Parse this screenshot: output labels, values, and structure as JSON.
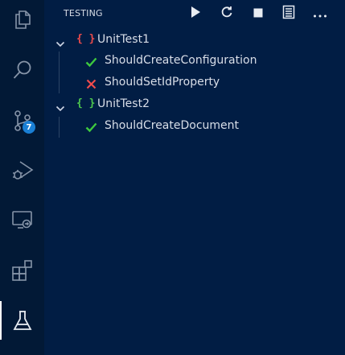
{
  "sidebar": {
    "title": "TESTING",
    "toolbar": [
      {
        "name": "run-all-tests-button",
        "icon": "play-icon"
      },
      {
        "name": "refresh-tests-button",
        "icon": "refresh-icon"
      },
      {
        "name": "stop-button",
        "icon": "stop-icon"
      },
      {
        "name": "show-output-button",
        "icon": "output-icon"
      },
      {
        "name": "more-actions-button",
        "icon": "ellipsis-icon"
      }
    ]
  },
  "activity_bar": {
    "items": [
      {
        "name": "explorer",
        "icon": "files-icon"
      },
      {
        "name": "search",
        "icon": "search-icon"
      },
      {
        "name": "source-control",
        "icon": "source-control-icon",
        "badge": "7"
      },
      {
        "name": "run-and-debug",
        "icon": "run-debug-icon"
      },
      {
        "name": "remote-explorer",
        "icon": "remote-explorer-icon"
      },
      {
        "name": "extensions",
        "icon": "extensions-icon"
      },
      {
        "name": "testing",
        "icon": "beaker-icon",
        "active": true
      }
    ]
  },
  "tree": {
    "groups": [
      {
        "label": "UnitTest1",
        "brace_color": "#f14c4c",
        "tests": [
          {
            "label": "ShouldCreateConfiguration",
            "status": "passed"
          },
          {
            "label": "ShouldSetIdProperty",
            "status": "failed"
          }
        ]
      },
      {
        "label": "UnitTest2",
        "brace_color": "#4ec94e",
        "tests": [
          {
            "label": "ShouldCreateDocument",
            "status": "passed"
          }
        ]
      }
    ]
  },
  "colors": {
    "passed": "#3ec93e",
    "failed": "#f14c4c",
    "background": "#011d44",
    "activity_background": "#021936",
    "badge": "#1a7fd4"
  }
}
